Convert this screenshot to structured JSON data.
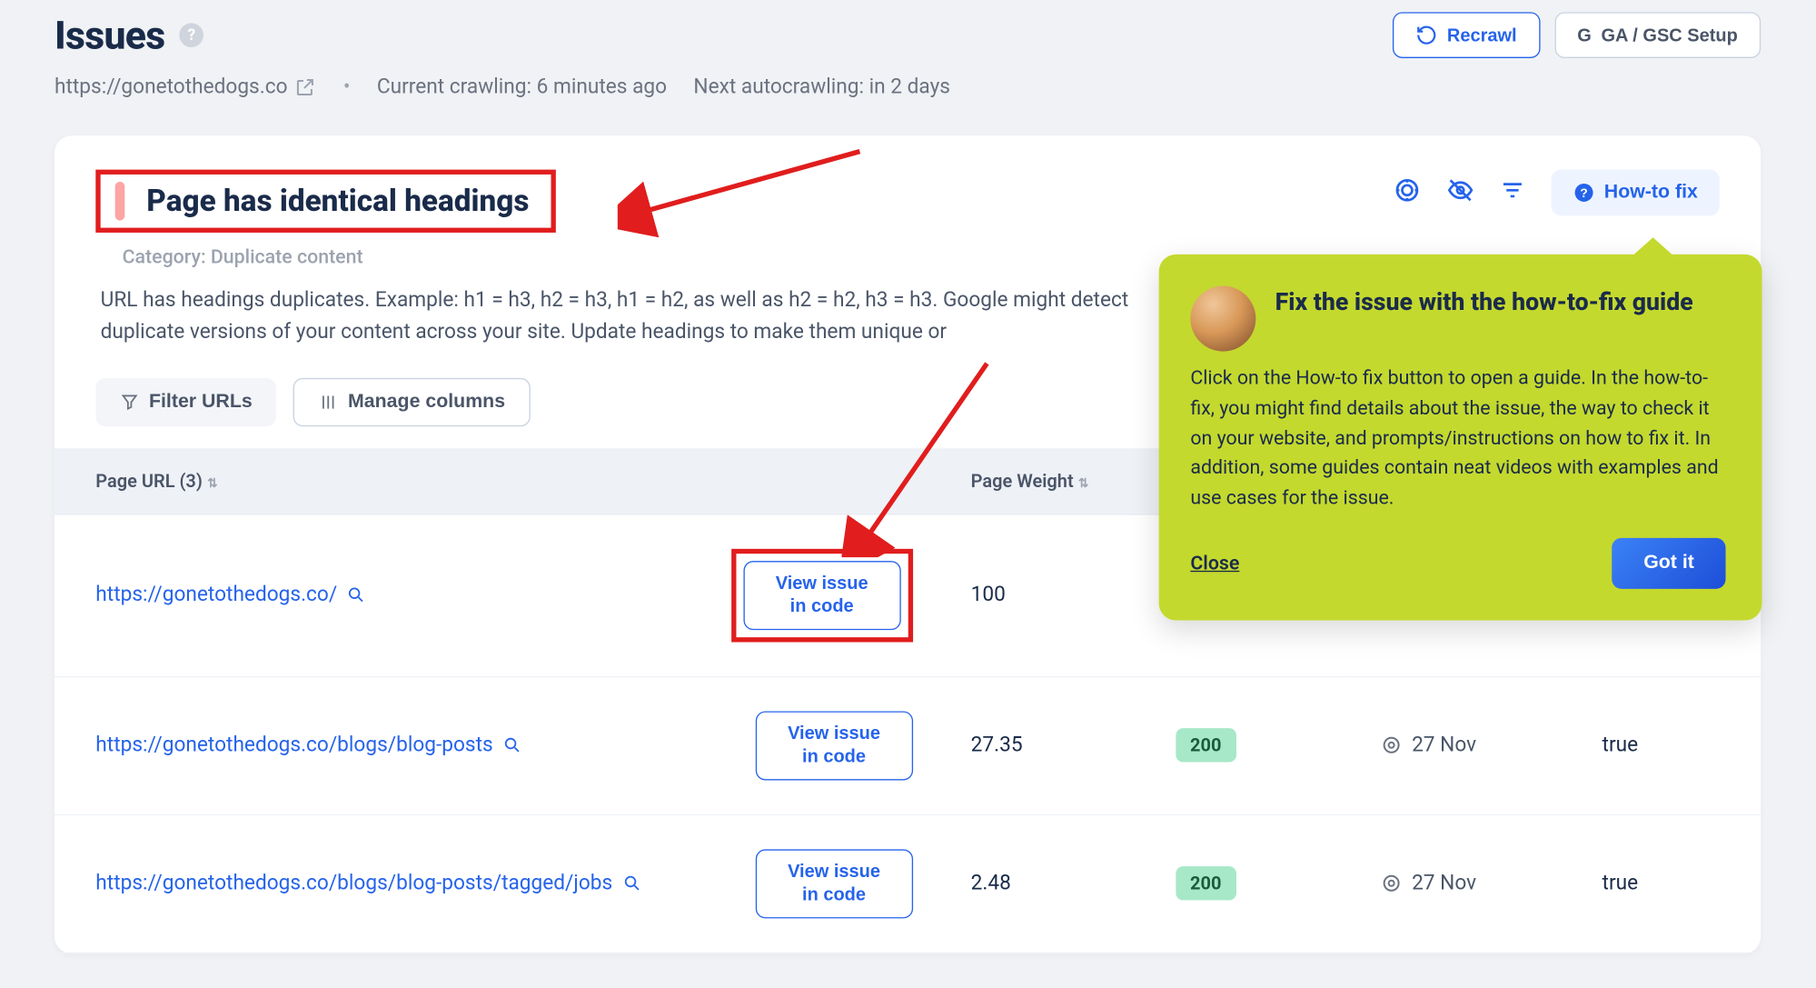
{
  "header": {
    "title": "Issues",
    "recrawl_label": "Recrawl",
    "ga_label": "GA / GSC Setup"
  },
  "meta": {
    "site_url": "https://gonetothedogs.co",
    "crawling_label": "Current crawling: 6 minutes ago",
    "next_label": "Next autocrawling: in 2 days"
  },
  "issue": {
    "title": "Page has identical headings",
    "category": "Category: Duplicate content",
    "description": "URL has headings duplicates. Example: h1 = h3, h2 = h3, h1 = h2, as well as h2 = h2, h3 = h3. Google might detect duplicate versions of your content across your site. Update headings to make them unique or",
    "howto_label": "How-to fix"
  },
  "actions": {
    "filter_label": "Filter URLs",
    "columns_label": "Manage columns"
  },
  "table": {
    "col_url": "Page URL (3)",
    "col_weight": "Page Weight",
    "col_date_header": "",
    "col_bool_header": "",
    "view_issue_label": "View issue in code",
    "rows": [
      {
        "url": "https://gonetothedogs.co/",
        "weight": "100",
        "status": "",
        "date": "",
        "bool": ""
      },
      {
        "url": "https://gonetothedogs.co/blogs/blog-posts",
        "weight": "27.35",
        "status": "200",
        "date": "27 Nov",
        "bool": "true"
      },
      {
        "url": "https://gonetothedogs.co/blogs/blog-posts/tagged/jobs",
        "weight": "2.48",
        "status": "200",
        "date": "27 Nov",
        "bool": "true"
      }
    ]
  },
  "popover": {
    "title": "Fix the issue with the how-to-fix guide",
    "body": "Click on the How-to fix button to open a guide. In the how-to-fix, you might find details about the issue, the way to check it on your website, and prompts/instructions on how to fix it. In addition, some guides contain neat videos with examples and use cases for the issue.",
    "close": "Close",
    "gotit": "Got it"
  }
}
